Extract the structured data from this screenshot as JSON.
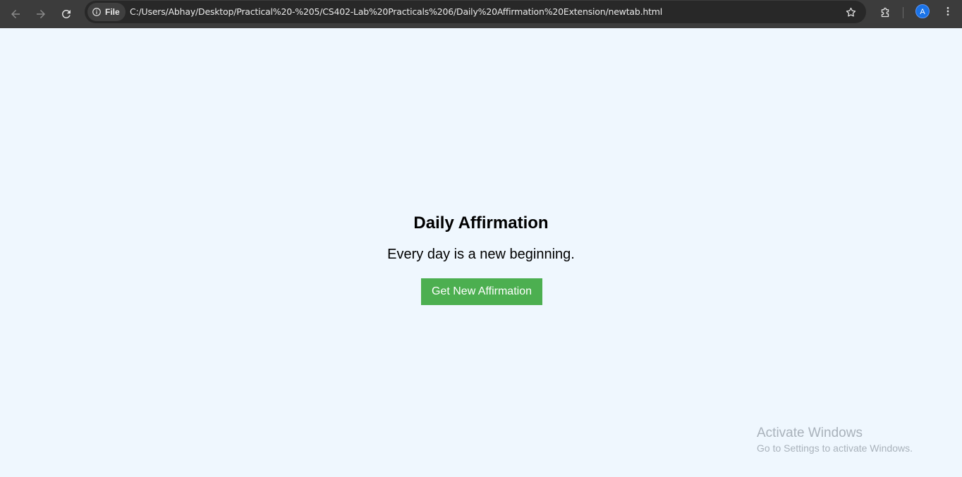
{
  "browser": {
    "security_chip_label": "File",
    "url": "C:/Users/Abhay/Desktop/Practical%20-%205/CS402-Lab%20Practicals%206/Daily%20Affirmation%20Extension/newtab.html",
    "profile_initial": "A"
  },
  "page": {
    "title": "Daily Affirmation",
    "affirmation": "Every day is a new beginning.",
    "button_label": "Get New Affirmation"
  },
  "watermark": {
    "title": "Activate Windows",
    "subtitle": "Go to Settings to activate Windows."
  },
  "colors": {
    "page_background": "#eff7fe",
    "button_background": "#4caf50",
    "toolbar_background": "#3c3c3c"
  }
}
